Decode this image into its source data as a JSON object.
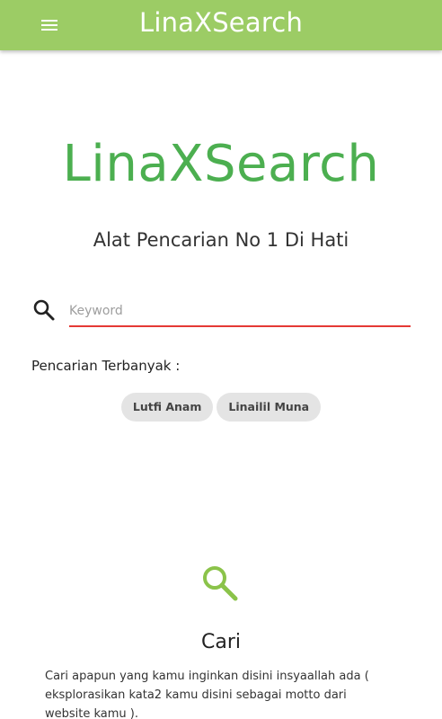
{
  "app": {
    "title": "LinaXSearch",
    "menu_icon": "hamburger-menu-icon",
    "colors": {
      "primary": "#9ccc65",
      "brand_text": "#4caf50",
      "input_underline": "#e53935",
      "chip_bg": "#e4e4e4",
      "feature_icon": "#8bc34a"
    }
  },
  "hero": {
    "title": "LinaXSearch",
    "subtitle": "Alat Pencarian No 1 Di Hati"
  },
  "search": {
    "icon": "search-icon",
    "placeholder": "Keyword",
    "value": ""
  },
  "popular": {
    "label": "Pencarian Terbanyak :",
    "chips": [
      "Lutfi Anam",
      "Linailil Muna"
    ]
  },
  "feature": {
    "icon": "search-icon",
    "title": "Cari",
    "text": "Cari apapun yang kamu inginkan disini insyaallah ada ( eksplorasikan kata2 kamu disini sebagai motto dari website kamu )."
  }
}
